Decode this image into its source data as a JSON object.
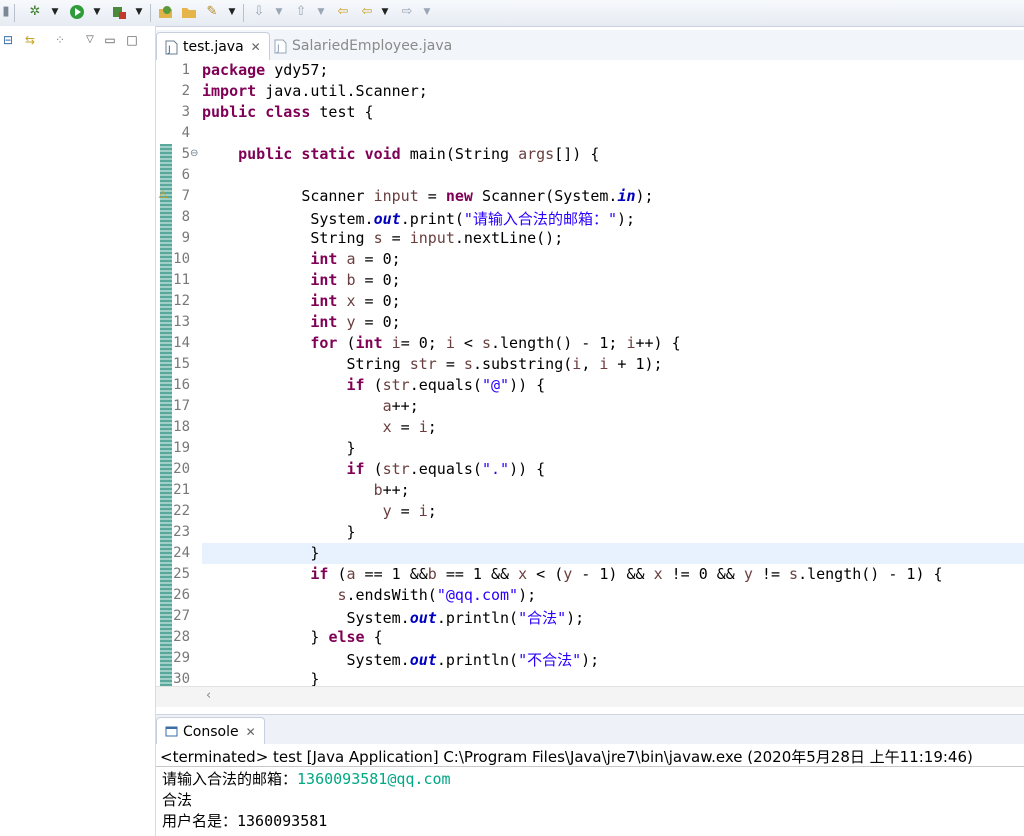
{
  "editor": {
    "tabs": [
      {
        "label": "test.java",
        "active": true
      },
      {
        "label": "SalariedEmployee.java",
        "active": false
      }
    ],
    "lines": [
      {
        "n": "1"
      },
      {
        "n": "2"
      },
      {
        "n": "3"
      },
      {
        "n": "4"
      },
      {
        "n": "5"
      },
      {
        "n": "6"
      },
      {
        "n": "7"
      },
      {
        "n": "8"
      },
      {
        "n": "9"
      },
      {
        "n": "10"
      },
      {
        "n": "11"
      },
      {
        "n": "12"
      },
      {
        "n": "13"
      },
      {
        "n": "14"
      },
      {
        "n": "15"
      },
      {
        "n": "16"
      },
      {
        "n": "17"
      },
      {
        "n": "18"
      },
      {
        "n": "19"
      },
      {
        "n": "20"
      },
      {
        "n": "21"
      },
      {
        "n": "22"
      },
      {
        "n": "23"
      },
      {
        "n": "24"
      },
      {
        "n": "25"
      },
      {
        "n": "26"
      },
      {
        "n": "27"
      },
      {
        "n": "28"
      },
      {
        "n": "29"
      },
      {
        "n": "30"
      }
    ],
    "code": [
      [
        [
          "kw",
          "package"
        ],
        [
          "t",
          " ydy57;"
        ]
      ],
      [
        [
          "kw",
          "import"
        ],
        [
          "t",
          " java.util.Scanner;"
        ]
      ],
      [
        [
          "kw",
          "public"
        ],
        [
          "t",
          " "
        ],
        [
          "kw",
          "class"
        ],
        [
          "t",
          " test {"
        ]
      ],
      [],
      [
        [
          "t",
          "    "
        ],
        [
          "kw",
          "public"
        ],
        [
          "t",
          " "
        ],
        [
          "kw",
          "static"
        ],
        [
          "t",
          " "
        ],
        [
          "kw",
          "void"
        ],
        [
          "t",
          " main(String "
        ],
        [
          "var",
          "args"
        ],
        [
          "t",
          "[]) {"
        ]
      ],
      [],
      [
        [
          "t",
          "           Scanner "
        ],
        [
          "var",
          "input"
        ],
        [
          "t",
          " = "
        ],
        [
          "kw",
          "new"
        ],
        [
          "t",
          " Scanner(System."
        ],
        [
          "fld",
          "in"
        ],
        [
          "t",
          ");"
        ]
      ],
      [
        [
          "t",
          "            System."
        ],
        [
          "fld",
          "out"
        ],
        [
          "t",
          ".print("
        ],
        [
          "str",
          "\"请输入合法的邮箱：\""
        ],
        [
          "t",
          ");"
        ]
      ],
      [
        [
          "t",
          "            String "
        ],
        [
          "var",
          "s"
        ],
        [
          "t",
          " = "
        ],
        [
          "var",
          "input"
        ],
        [
          "t",
          ".nextLine();"
        ]
      ],
      [
        [
          "t",
          "            "
        ],
        [
          "kw",
          "int"
        ],
        [
          "t",
          " "
        ],
        [
          "var",
          "a"
        ],
        [
          "t",
          " = 0;"
        ]
      ],
      [
        [
          "t",
          "            "
        ],
        [
          "kw",
          "int"
        ],
        [
          "t",
          " "
        ],
        [
          "var",
          "b"
        ],
        [
          "t",
          " = 0;"
        ]
      ],
      [
        [
          "t",
          "            "
        ],
        [
          "kw",
          "int"
        ],
        [
          "t",
          " "
        ],
        [
          "var",
          "x"
        ],
        [
          "t",
          " = 0;"
        ]
      ],
      [
        [
          "t",
          "            "
        ],
        [
          "kw",
          "int"
        ],
        [
          "t",
          " "
        ],
        [
          "var",
          "y"
        ],
        [
          "t",
          " = 0;"
        ]
      ],
      [
        [
          "t",
          "            "
        ],
        [
          "kw",
          "for"
        ],
        [
          "t",
          " ("
        ],
        [
          "kw",
          "int"
        ],
        [
          "t",
          " "
        ],
        [
          "var",
          "i"
        ],
        [
          "t",
          "= 0; "
        ],
        [
          "var",
          "i"
        ],
        [
          "t",
          " < "
        ],
        [
          "var",
          "s"
        ],
        [
          "t",
          ".length() - 1; "
        ],
        [
          "var",
          "i"
        ],
        [
          "t",
          "++) {"
        ]
      ],
      [
        [
          "t",
          "                String "
        ],
        [
          "var",
          "str"
        ],
        [
          "t",
          " = "
        ],
        [
          "var",
          "s"
        ],
        [
          "t",
          ".substring("
        ],
        [
          "var",
          "i"
        ],
        [
          "t",
          ", "
        ],
        [
          "var",
          "i"
        ],
        [
          "t",
          " + 1);"
        ]
      ],
      [
        [
          "t",
          "                "
        ],
        [
          "kw",
          "if"
        ],
        [
          "t",
          " ("
        ],
        [
          "var",
          "str"
        ],
        [
          "t",
          ".equals("
        ],
        [
          "str",
          "\"@\""
        ],
        [
          "t",
          ")) {"
        ]
      ],
      [
        [
          "t",
          "                    "
        ],
        [
          "var",
          "a"
        ],
        [
          "t",
          "++;"
        ]
      ],
      [
        [
          "t",
          "                    "
        ],
        [
          "var",
          "x"
        ],
        [
          "t",
          " = "
        ],
        [
          "var",
          "i"
        ],
        [
          "t",
          ";"
        ]
      ],
      [
        [
          "t",
          "                }"
        ]
      ],
      [
        [
          "t",
          "                "
        ],
        [
          "kw",
          "if"
        ],
        [
          "t",
          " ("
        ],
        [
          "var",
          "str"
        ],
        [
          "t",
          ".equals("
        ],
        [
          "str",
          "\".\""
        ],
        [
          "t",
          ")) {"
        ]
      ],
      [
        [
          "t",
          "                   "
        ],
        [
          "var",
          "b"
        ],
        [
          "t",
          "++;"
        ]
      ],
      [
        [
          "t",
          "                    "
        ],
        [
          "var",
          "y"
        ],
        [
          "t",
          " = "
        ],
        [
          "var",
          "i"
        ],
        [
          "t",
          ";"
        ]
      ],
      [
        [
          "t",
          "                }"
        ]
      ],
      [
        [
          "t",
          "            }"
        ]
      ],
      [
        [
          "t",
          "            "
        ],
        [
          "kw",
          "if"
        ],
        [
          "t",
          " ("
        ],
        [
          "var",
          "a"
        ],
        [
          "t",
          " == 1 &&"
        ],
        [
          "var",
          "b"
        ],
        [
          "t",
          " == 1 && "
        ],
        [
          "var",
          "x"
        ],
        [
          "t",
          " < ("
        ],
        [
          "var",
          "y"
        ],
        [
          "t",
          " - 1) && "
        ],
        [
          "var",
          "x"
        ],
        [
          "t",
          " != 0 && "
        ],
        [
          "var",
          "y"
        ],
        [
          "t",
          " != "
        ],
        [
          "var",
          "s"
        ],
        [
          "t",
          ".length() - 1) {"
        ]
      ],
      [
        [
          "t",
          "               "
        ],
        [
          "var",
          "s"
        ],
        [
          "t",
          ".endsWith("
        ],
        [
          "str",
          "\"@qq.com\""
        ],
        [
          "t",
          ");"
        ]
      ],
      [
        [
          "t",
          "                System."
        ],
        [
          "fld",
          "out"
        ],
        [
          "t",
          ".println("
        ],
        [
          "str",
          "\"合法\""
        ],
        [
          "t",
          ");"
        ]
      ],
      [
        [
          "t",
          "            } "
        ],
        [
          "kw",
          "else"
        ],
        [
          "t",
          " {"
        ]
      ],
      [
        [
          "t",
          "                System."
        ],
        [
          "fld",
          "out"
        ],
        [
          "t",
          ".println("
        ],
        [
          "str",
          "\"不合法\""
        ],
        [
          "t",
          ");"
        ]
      ],
      [
        [
          "t",
          "            }"
        ]
      ]
    ]
  },
  "console": {
    "tab_label": "Console",
    "terminated": "<terminated> test [Java Application] C:\\Program Files\\Java\\jre7\\bin\\javaw.exe (2020年5月28日 上午11:19:46)",
    "output": [
      {
        "prompt": "请输入合法的邮箱：",
        "input": "1360093581@qq.com"
      },
      {
        "prompt": "合法",
        "input": ""
      },
      {
        "prompt": "用户名是：1360093581",
        "input": ""
      }
    ]
  },
  "colors": {
    "keyword": "#7f0055",
    "string": "#2a00ff",
    "field": "#0000c0",
    "variable": "#6a3e3e",
    "console_input": "#00a884",
    "current_line": "#e8f2fe"
  },
  "icons": {
    "toolbar": [
      "debug-icon",
      "run-icon",
      "external-tools-icon",
      "open-type-icon",
      "open-folder-icon",
      "search-tool-icon",
      "annotation-icon",
      "next-edit-icon",
      "back-icon",
      "forward-icon"
    ],
    "left_pane": [
      "collapse-all-icon",
      "link-editor-icon",
      "view-menu-icon",
      "minimize-icon",
      "maximize-icon"
    ]
  }
}
